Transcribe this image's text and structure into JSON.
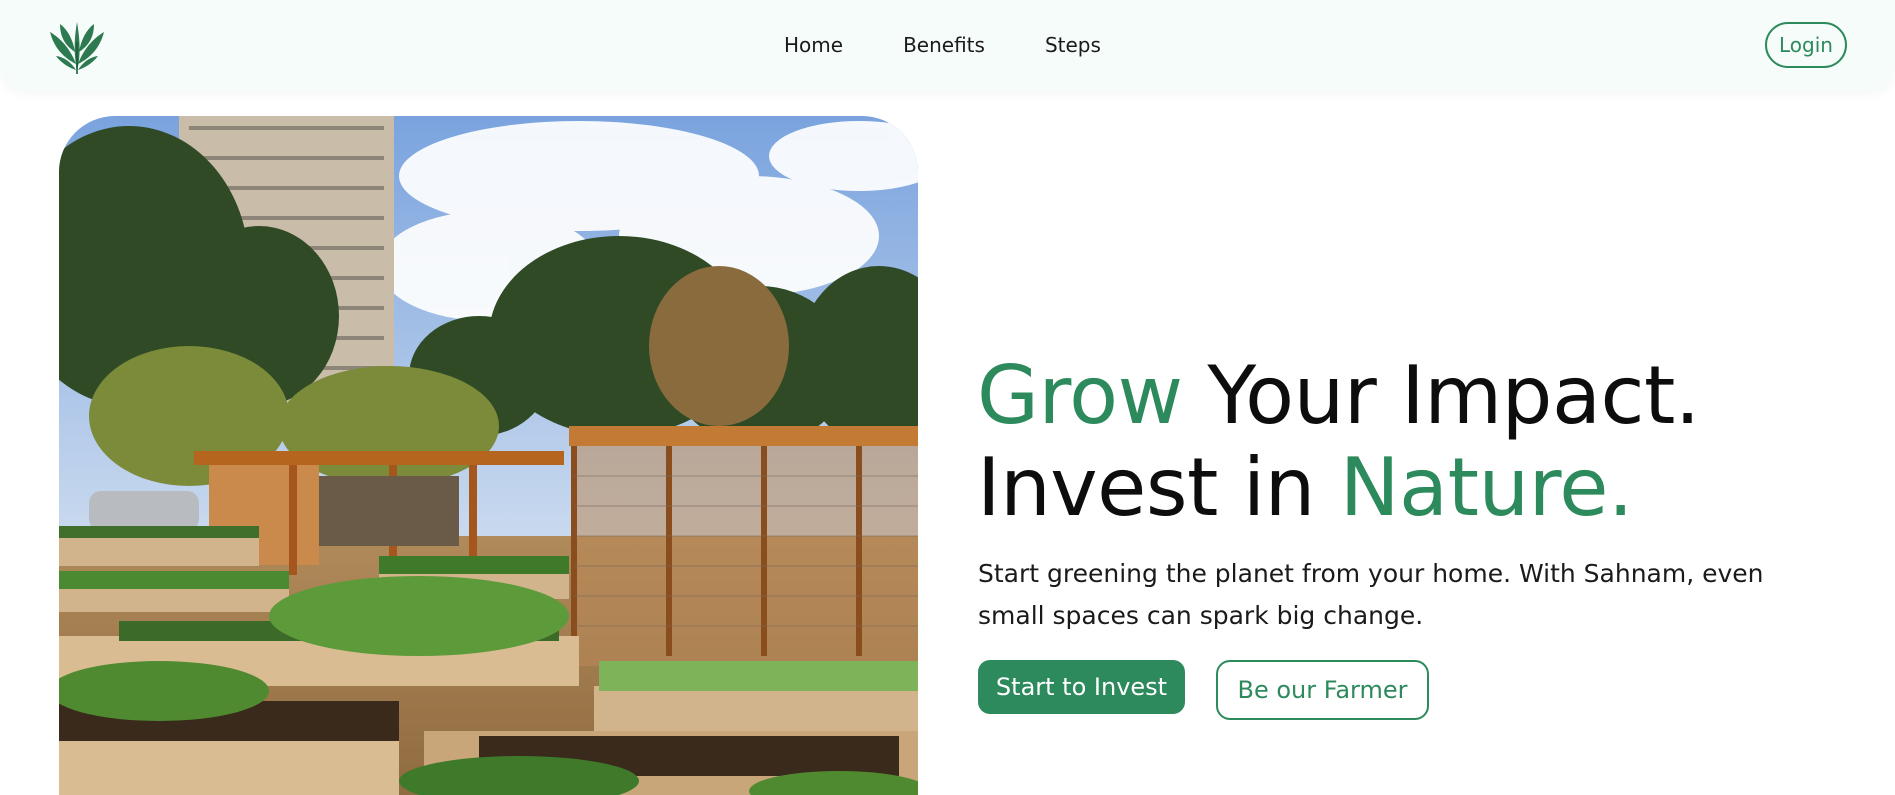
{
  "brand": {
    "logo_icon": "leaf-icon",
    "color": "#2d8a5c"
  },
  "nav": {
    "links": [
      {
        "label": "Home"
      },
      {
        "label": "Benefits"
      },
      {
        "label": "Steps"
      }
    ],
    "login_label": "Login"
  },
  "hero": {
    "image_icon": "community-garden-photo",
    "headline_line1_accent": "Grow",
    "headline_line1_rest": " Your Impact.",
    "headline_line2_rest": "Invest in ",
    "headline_line2_accent": "Nature.",
    "subtext": "Start greening the planet from your home. With Sahnam, even small spaces can spark big change.",
    "primary_cta": "Start to Invest",
    "secondary_cta": "Be our Farmer"
  },
  "colors": {
    "accent": "#2d8a5c",
    "navbar_bg": "#f6fcfa",
    "text": "#0d0d0d"
  }
}
